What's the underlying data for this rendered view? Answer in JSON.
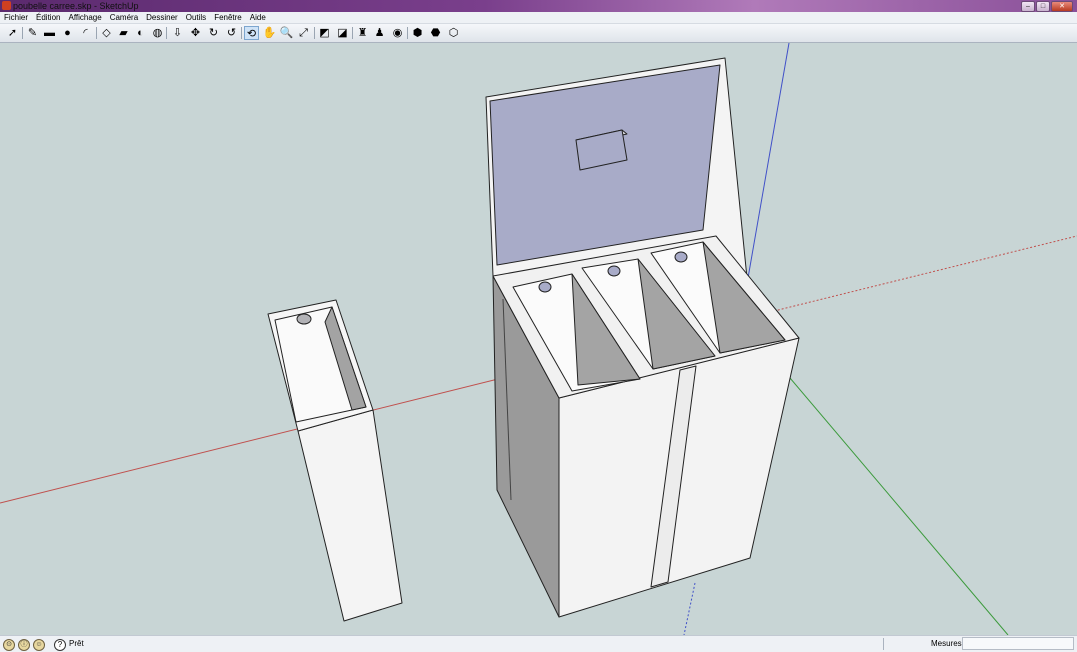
{
  "window": {
    "title": "poubelle carree.skp - SketchUp",
    "controls": [
      "–",
      "□",
      "✕"
    ]
  },
  "menubar": [
    "Fichier",
    "Édition",
    "Affichage",
    "Caméra",
    "Dessiner",
    "Outils",
    "Fenêtre",
    "Aide"
  ],
  "toolbar": [
    {
      "name": "select-icon",
      "glyph": "➚"
    },
    {
      "name": "pencil-icon",
      "glyph": "✎"
    },
    {
      "name": "rectangle-icon",
      "glyph": "▬"
    },
    {
      "name": "circle-icon",
      "glyph": "●"
    },
    {
      "name": "arc-icon",
      "glyph": "◜"
    },
    {
      "name": "make-component-icon",
      "glyph": "◇"
    },
    {
      "name": "eraser-icon",
      "glyph": "▰"
    },
    {
      "name": "tape-measure-icon",
      "glyph": "◐"
    },
    {
      "name": "paint-bucket-icon",
      "glyph": "◍"
    },
    {
      "name": "push-pull-icon",
      "glyph": "⇩"
    },
    {
      "name": "move-icon",
      "glyph": "✥"
    },
    {
      "name": "rotate-icon",
      "glyph": "↻"
    },
    {
      "name": "offset-icon",
      "glyph": "↺"
    },
    {
      "name": "orbit-icon",
      "glyph": "⟲",
      "active": true
    },
    {
      "name": "pan-icon",
      "glyph": "✋"
    },
    {
      "name": "zoom-icon",
      "glyph": "🔍"
    },
    {
      "name": "zoom-extents-icon",
      "glyph": "⤢"
    },
    {
      "name": "previous-view-icon",
      "glyph": "◩"
    },
    {
      "name": "next-view-icon",
      "glyph": "◪"
    },
    {
      "name": "place-camera-icon",
      "glyph": "♜"
    },
    {
      "name": "walk-icon",
      "glyph": "♟"
    },
    {
      "name": "look-around-icon",
      "glyph": "◉"
    },
    {
      "name": "get-models-icon",
      "glyph": "⬢"
    },
    {
      "name": "share-model-icon",
      "glyph": "⬣"
    },
    {
      "name": "share-component-icon",
      "glyph": "⬡"
    }
  ],
  "colors": {
    "viewport": "#c8d5d5",
    "lid": "#a8abc8",
    "axis_red": "#c0504d",
    "axis_green": "#3b9a3b",
    "axis_blue": "#4050c8"
  },
  "status": {
    "text": "Prêt",
    "value_label": "Mesures",
    "value": ""
  }
}
